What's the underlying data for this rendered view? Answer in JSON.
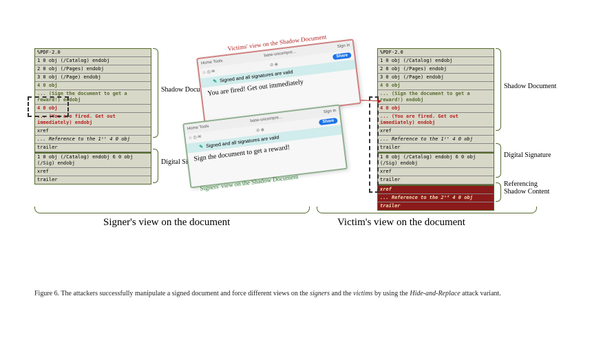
{
  "left_box": {
    "header": "%PDF-2.0",
    "lines": [
      {
        "text": "1 0 obj (/Catalog) endobj"
      },
      {
        "text": "2 0 obj (/Pages) endobj"
      },
      {
        "text": "3 0 obj (/Page) endobj"
      },
      {
        "text": "4 0 obj",
        "style": "green"
      },
      {
        "text": "... (Sign the document to get a reward!) endobj",
        "style": "green"
      },
      {
        "text": "4 0 obj",
        "style": "red"
      },
      {
        "text": "... (You are fired. Get out immediately) endobj",
        "style": "red"
      },
      {
        "text": "xref"
      },
      {
        "text": "...\nReference to the 1ˢᵗ 4 0 obj",
        "style": "italic"
      },
      {
        "text": "trailer"
      },
      {
        "text": "1 0 obj (/Catalog) endobj\n6 0 obj (/Sig) endobj",
        "section": true
      },
      {
        "text": "xref"
      },
      {
        "text": "trailer"
      }
    ]
  },
  "right_box": {
    "header": "%PDF-2.0",
    "lines": [
      {
        "text": "1 0 obj (/Catalog) endobj"
      },
      {
        "text": "2 0 obj (/Pages) endobj"
      },
      {
        "text": "3 0 obj (/Page) endobj"
      },
      {
        "text": "4 0 obj",
        "style": "green"
      },
      {
        "text": "... (Sign the document to get a reward!) endobj",
        "style": "green"
      },
      {
        "text": "4 0 obj",
        "style": "red"
      },
      {
        "text": "... (You are fired. Get out immediately) endobj",
        "style": "red"
      },
      {
        "text": "xref"
      },
      {
        "text": "...\nReference to the 1ˢᵗ 4 0 obj",
        "style": "italic"
      },
      {
        "text": "trailer"
      },
      {
        "text": "1 0 obj (/Catalog) endobj\n6 0 obj (/Sig) endobj",
        "section": true
      },
      {
        "text": "xref"
      },
      {
        "text": "trailer"
      },
      {
        "text": "xref",
        "block": "red"
      },
      {
        "text": "... Reference to the 2ⁿᵈ 4 0 obj",
        "block": "red",
        "style": "italic"
      },
      {
        "text": "trailer",
        "block": "red"
      }
    ]
  },
  "brace_labels": {
    "left_shadow": "Shadow\nDocument",
    "left_sig": "Digital\nSignature",
    "right_shadow": "Shadow\nDocument",
    "right_sig": "Digital\nSignature",
    "right_ref": "Referencing\nShadow\nContent"
  },
  "bottom_labels": {
    "left": "Signer's view on the document",
    "right": "Victim's view on the document"
  },
  "center": {
    "victim_label": "Victims' view on the Shadow Document",
    "signer_label": "Signers' view on the Shadow Document",
    "toolbar_left": "Home   Tools",
    "toolbar_file": "base-uncompre...",
    "toolbar_signin": "Sign In",
    "share": "Share",
    "sig_valid": "Signed and all signatures are valid",
    "card_top_body": "You are fired! Get out immediately",
    "card_bottom_body": "Sign the document to get a reward!"
  },
  "caption": {
    "prefix": "Figure 6.   The attackers successfully manipulate a signed document and force different views on the ",
    "em1": "signers",
    "mid": " and the ",
    "em2": "victims",
    "mid2": " by using the ",
    "em3": "Hide-and-Replace",
    "suffix": " attack variant."
  }
}
